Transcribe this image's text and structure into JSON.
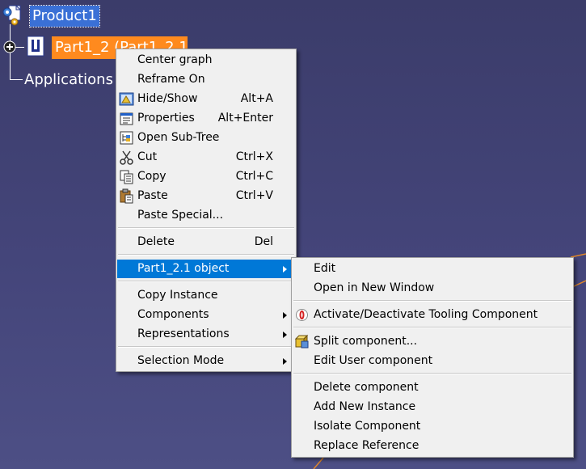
{
  "tree": {
    "root_label": "Product1",
    "part_label": "Part1_2 (Part1_2.1)",
    "applications_label": "Applications"
  },
  "context_menu": {
    "center_graph": "Center graph",
    "reframe_on": "Reframe On",
    "hide_show": "Hide/Show",
    "hide_show_shortcut": "Alt+A",
    "properties": "Properties",
    "properties_shortcut": "Alt+Enter",
    "open_sub_tree": "Open Sub-Tree",
    "cut": "Cut",
    "cut_shortcut": "Ctrl+X",
    "copy": "Copy",
    "copy_shortcut": "Ctrl+C",
    "paste": "Paste",
    "paste_shortcut": "Ctrl+V",
    "paste_special": "Paste Special...",
    "delete": "Delete",
    "delete_shortcut": "Del",
    "object_submenu": "Part1_2.1 object",
    "copy_instance": "Copy Instance",
    "components": "Components",
    "representations": "Representations",
    "selection_mode": "Selection Mode"
  },
  "submenu": {
    "edit": "Edit",
    "open_new_window": "Open in New Window",
    "activate_tooling": "Activate/Deactivate Tooling Component",
    "split_component": "Split component...",
    "edit_user_component": "Edit User component",
    "delete_component": "Delete component",
    "add_new_instance": "Add New Instance",
    "isolate_component": "Isolate Component",
    "replace_reference": "Replace Reference"
  },
  "colors": {
    "background": "#44457a",
    "highlight": "#0078d7",
    "selection": "#3a70d6",
    "part_highlight": "#ff8a1e"
  }
}
